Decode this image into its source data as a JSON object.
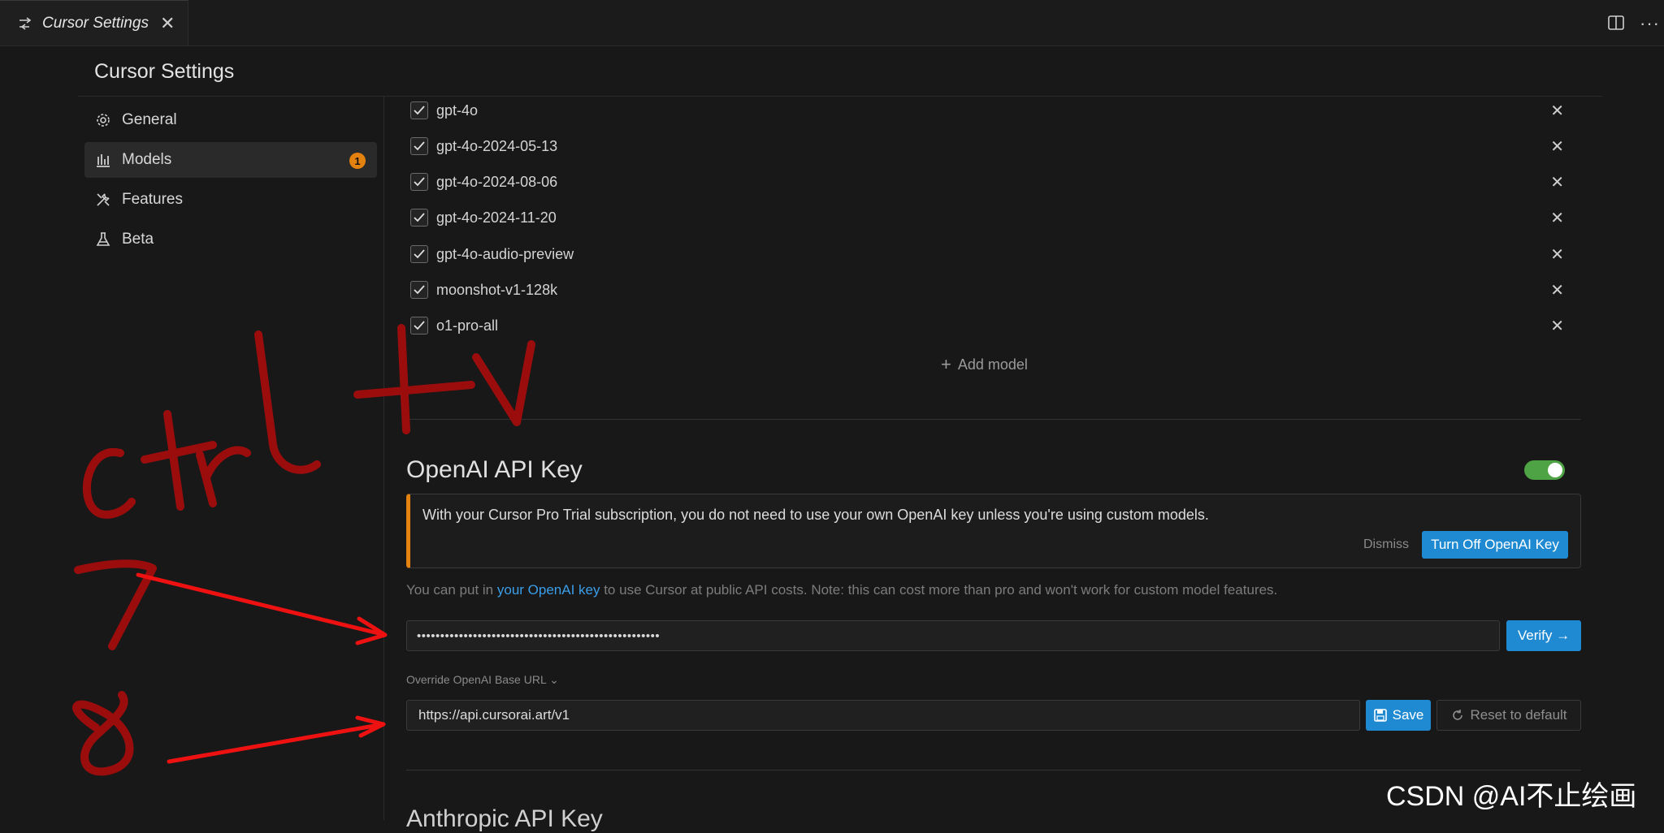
{
  "tab": {
    "title": "Cursor Settings",
    "icon": "settings-sliders-icon",
    "close_glyph": "✕"
  },
  "header": {
    "title": "Cursor Settings",
    "more_glyph": "···"
  },
  "sidebar": {
    "items": [
      {
        "label": "General",
        "icon": "gear-icon"
      },
      {
        "label": "Models",
        "icon": "chart-icon",
        "badge": "1"
      },
      {
        "label": "Features",
        "icon": "tools-icon"
      },
      {
        "label": "Beta",
        "icon": "flask-icon"
      }
    ]
  },
  "models": {
    "items": [
      {
        "name": "gpt-4o",
        "checked": true
      },
      {
        "name": "gpt-4o-2024-05-13",
        "checked": true
      },
      {
        "name": "gpt-4o-2024-08-06",
        "checked": true
      },
      {
        "name": "gpt-4o-2024-11-20",
        "checked": true
      },
      {
        "name": "gpt-4o-audio-preview",
        "checked": true
      },
      {
        "name": "moonshot-v1-128k",
        "checked": true
      },
      {
        "name": "o1-pro-all",
        "checked": true
      }
    ],
    "add_label": "Add model"
  },
  "openai": {
    "title": "OpenAI API Key",
    "enabled": true,
    "notice": "With your Cursor Pro Trial subscription, you do not need to use your own OpenAI key unless you're using custom models.",
    "dismiss_label": "Dismiss",
    "turn_off_label": "Turn Off OpenAI Key",
    "help_prefix": "You can put in ",
    "help_link": "your OpenAI key",
    "help_suffix": " to use Cursor at public API costs. Note: this can cost more than pro and won't work for custom model features.",
    "key_value": "••••••••••••••••••••••••••••••••••••••••••••••••••••",
    "verify_label": "Verify →",
    "override_label": "Override OpenAI Base URL ⌄",
    "base_url": "https://api.cursorai.art/v1",
    "save_label": "Save",
    "reset_label": "Reset to default"
  },
  "next_section": {
    "title": "Anthropic API Key"
  },
  "annotations": {
    "handwriting_text": "ctrl+v",
    "step_a": "7",
    "step_b": "8",
    "color": "#9b0d0d",
    "arrow_color": "#ee1111"
  },
  "watermark": "CSDN @AI不止绘画",
  "colors": {
    "accent_blue": "#1f8ad2",
    "toggle_green": "#4ea344",
    "badge_orange": "#e4820f"
  }
}
